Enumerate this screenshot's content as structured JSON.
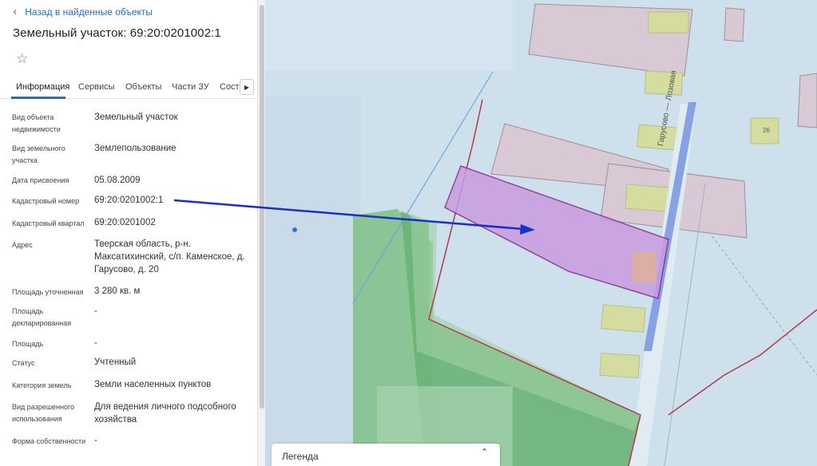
{
  "panel": {
    "back_label": "Назад в найденные объекты",
    "title": "Земельный участок: 69:20:0201002:1",
    "tabs": [
      {
        "label": "Информация",
        "active": true
      },
      {
        "label": "Сервисы"
      },
      {
        "label": "Объекты"
      },
      {
        "label": "Части ЗУ"
      },
      {
        "label": "Соста"
      }
    ],
    "properties": [
      {
        "label": "Вид объекта недвижимости",
        "value": "Земельный участок"
      },
      {
        "label": "Вид земельного участка",
        "value": "Землепользование"
      },
      {
        "label": "Дата присвоения",
        "value": "05.08.2009"
      },
      {
        "label": "Кадастровый номер",
        "value": "69:20:0201002:1"
      },
      {
        "label": "Кадастровый квартал",
        "value": "69:20:0201002"
      },
      {
        "label": "Адрес",
        "value": "Тверская область, р-н. Максатихинский, с/п. Каменское, д. Гарусово, д. 20"
      },
      {
        "label": "Площадь уточненная",
        "value": "3 280 кв. м"
      },
      {
        "label": "Площадь декларированная",
        "value": "-"
      },
      {
        "label": "Площадь",
        "value": "-"
      },
      {
        "label": "Статус",
        "value": "Учтенный"
      },
      {
        "label": "Категория земель",
        "value": "Земли населенных пунктов"
      },
      {
        "label": "Вид разрешенного использования",
        "value": "Для ведения личного подсобного хозяйства"
      },
      {
        "label": "Форма собственности",
        "value": "-"
      }
    ]
  },
  "map": {
    "street_label": "Гарусово — Лозовая",
    "house_number": "26",
    "legend_title": "Легенда"
  },
  "colors": {
    "accent": "#1e6fc7",
    "parcel_fill": "#c99be0",
    "parcel_stroke": "#8a2c8a",
    "arrow": "#1a2fc4",
    "green_zone": "#5bb06a",
    "water": "#6f8fe0"
  }
}
